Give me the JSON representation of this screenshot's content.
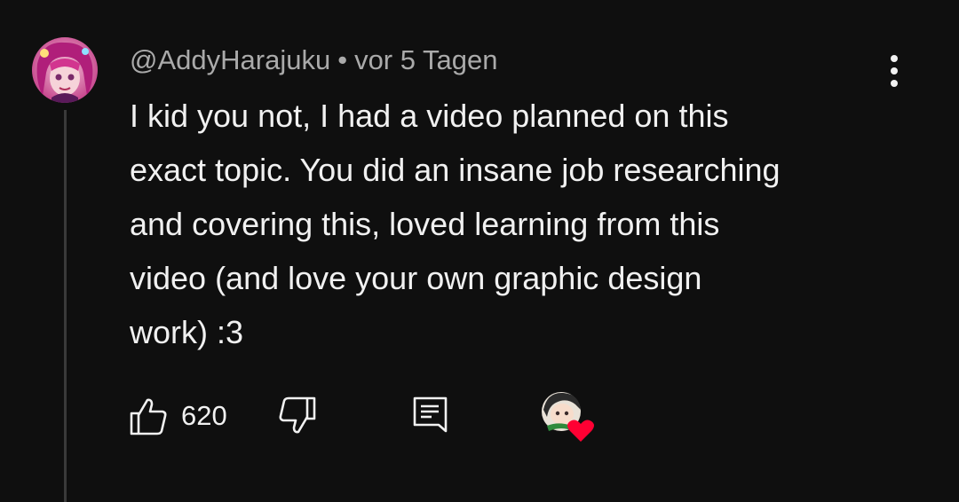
{
  "comment": {
    "author": "@AddyHarajuku",
    "separator": "•",
    "timestamp": "vor 5 Tagen",
    "text_lines": [
      "I kid you not, I had a video planned on this",
      "exact topic. You did an insane job researching",
      "and covering this, loved learning from this",
      "video (and love your own graphic design",
      "work) :3"
    ],
    "like_count": "620"
  },
  "icons": {
    "menu": "more-vertical-icon",
    "like": "thumb-up-icon",
    "dislike": "thumb-down-icon",
    "reply": "reply-comment-icon",
    "hearted": "creator-heart-icon"
  },
  "colors": {
    "background": "#0f0f0f",
    "text_primary": "#f1f1f1",
    "text_secondary": "#aaaaaa",
    "heart": "#ff0033"
  }
}
